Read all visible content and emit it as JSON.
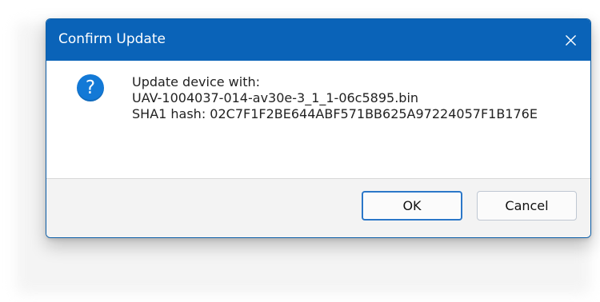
{
  "dialog": {
    "title": "Confirm Update",
    "message": {
      "line1": "Update device with:",
      "line2": "UAV-1004037-014-av30e-3_1_1-06c5895.bin",
      "line3": "SHA1 hash: 02C7F1F2BE644ABF571BB625A97224057F1B176E"
    },
    "buttons": {
      "ok": "OK",
      "cancel": "Cancel"
    }
  },
  "icons": {
    "question": "question-mark-icon",
    "close": "close-icon"
  },
  "colors": {
    "titlebar": "#0a63b8",
    "question_icon": "#1379d6",
    "ok_border": "#2b77c8",
    "footer": "#f3f3f3"
  }
}
